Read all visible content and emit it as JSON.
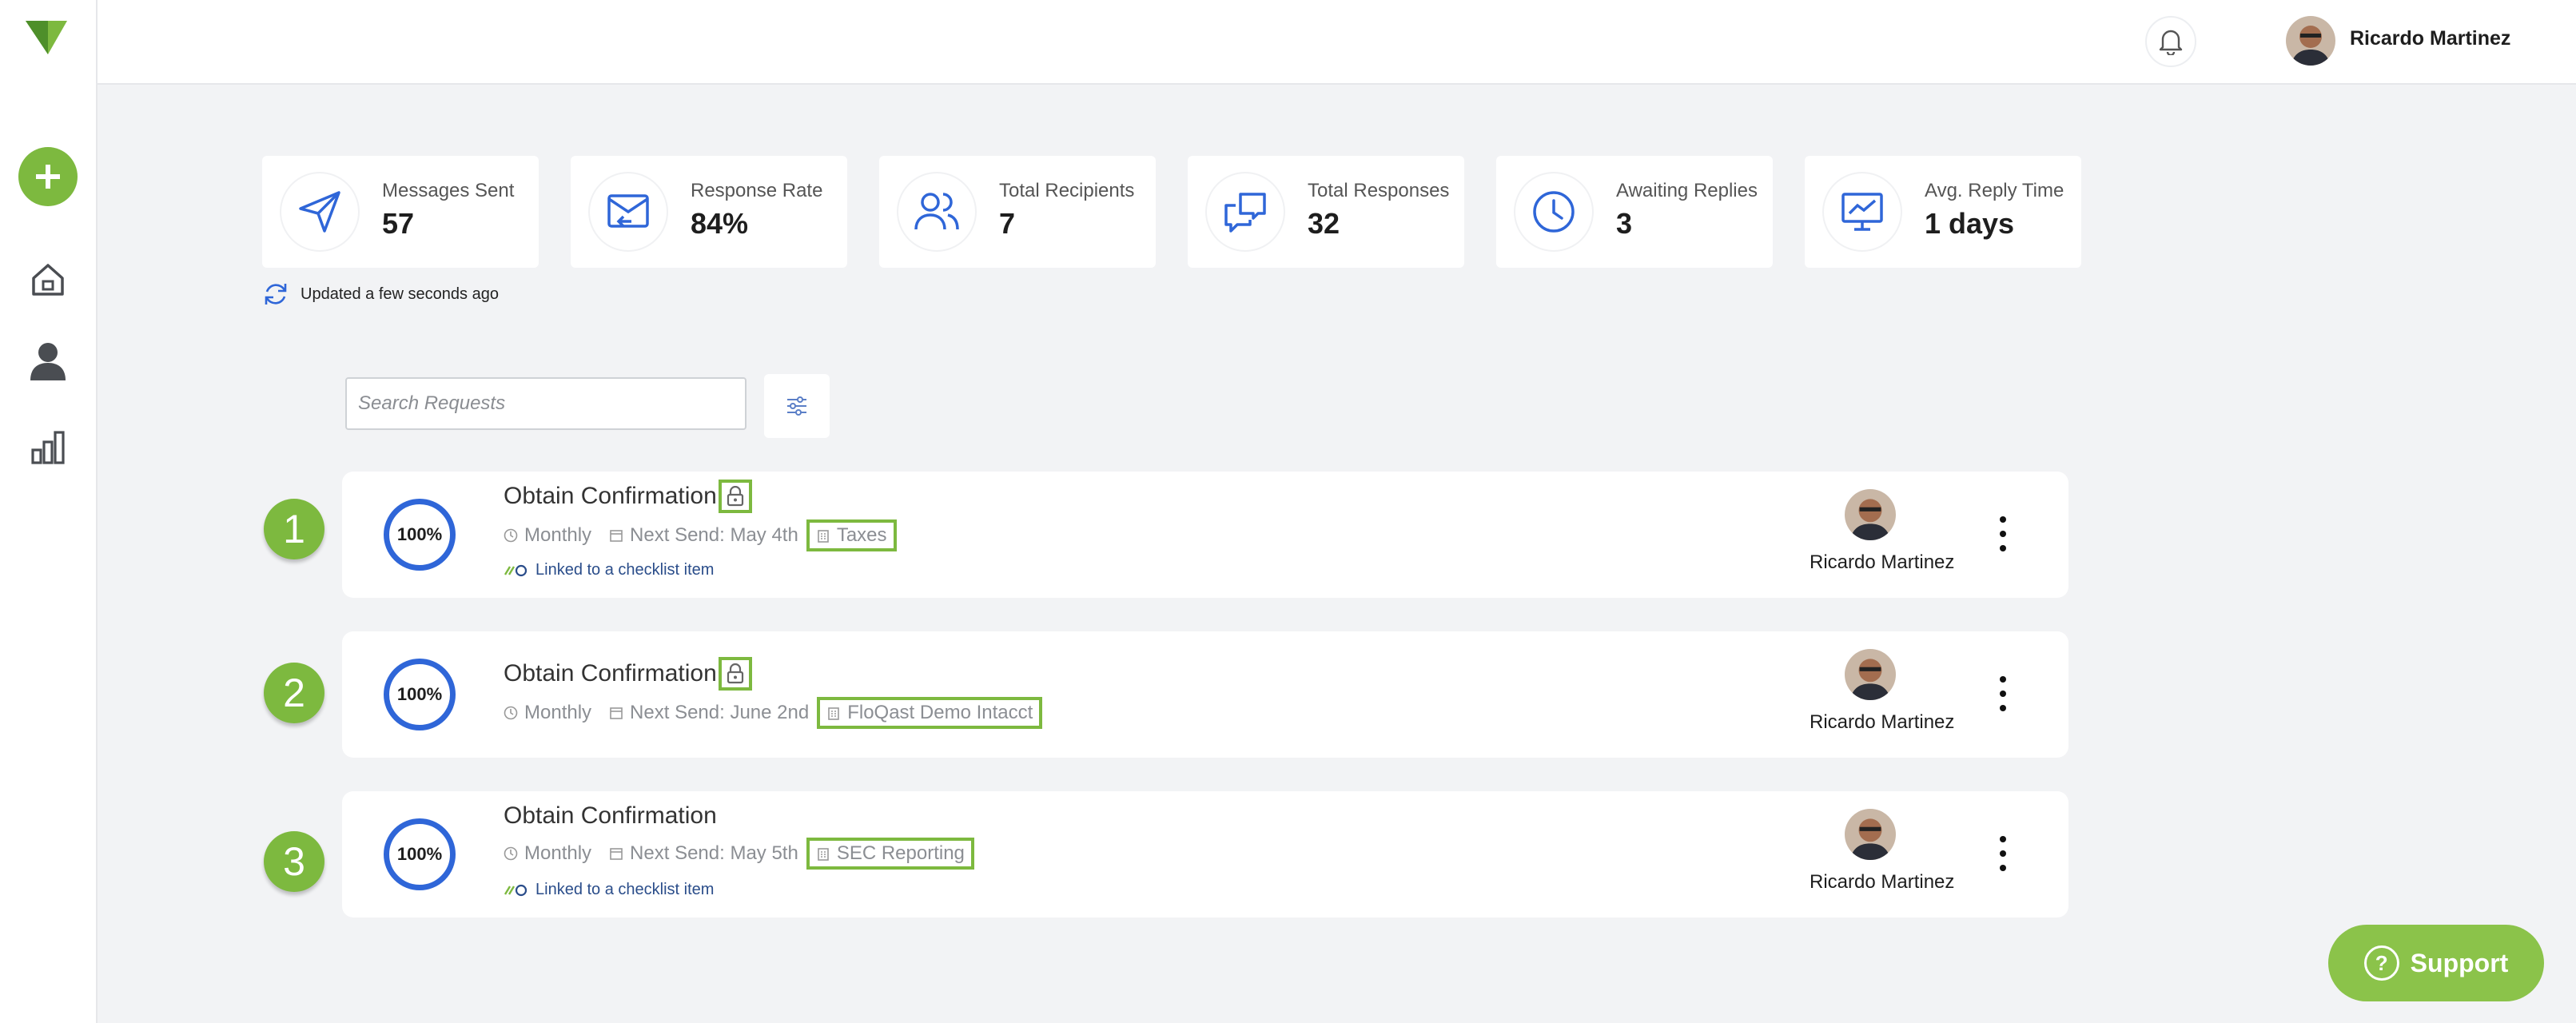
{
  "header": {
    "user_name": "Ricardo Martinez"
  },
  "stats": [
    {
      "label": "Messages Sent",
      "value": "57",
      "icon": "send-icon"
    },
    {
      "label": "Response Rate",
      "value": "84%",
      "icon": "mail-reply-icon"
    },
    {
      "label": "Total Recipients",
      "value": "7",
      "icon": "users-icon"
    },
    {
      "label": "Total Responses",
      "value": "32",
      "icon": "chat-bubbles-icon"
    },
    {
      "label": "Awaiting Replies",
      "value": "3",
      "icon": "clock-icon"
    },
    {
      "label": "Avg. Reply Time",
      "value": "1 days",
      "icon": "monitor-chart-icon"
    }
  ],
  "updated_text": "Updated a few seconds ago",
  "search": {
    "placeholder": "Search Requests",
    "value": ""
  },
  "requests": [
    {
      "number": "1",
      "progress": "100%",
      "title": "Obtain Confirmation",
      "locked": true,
      "frequency": "Monthly",
      "next_send": "Next Send: May 4th",
      "tag": "Taxes",
      "linked": "Linked to a checklist item",
      "owner": "Ricardo Martinez"
    },
    {
      "number": "2",
      "progress": "100%",
      "title": "Obtain Confirmation",
      "locked": true,
      "frequency": "Monthly",
      "next_send": "Next Send: June 2nd",
      "tag": "FloQast Demo Intacct",
      "linked": "",
      "owner": "Ricardo Martinez"
    },
    {
      "number": "3",
      "progress": "100%",
      "title": "Obtain Confirmation",
      "locked": false,
      "frequency": "Monthly",
      "next_send": "Next Send: May 5th",
      "tag": "SEC Reporting",
      "linked": "Linked to a checklist item",
      "owner": "Ricardo Martinez"
    }
  ],
  "support_label": "Support",
  "colors": {
    "accent_green": "#7db93f",
    "primary_blue": "#2f66d8",
    "background": "#f2f3f5"
  }
}
